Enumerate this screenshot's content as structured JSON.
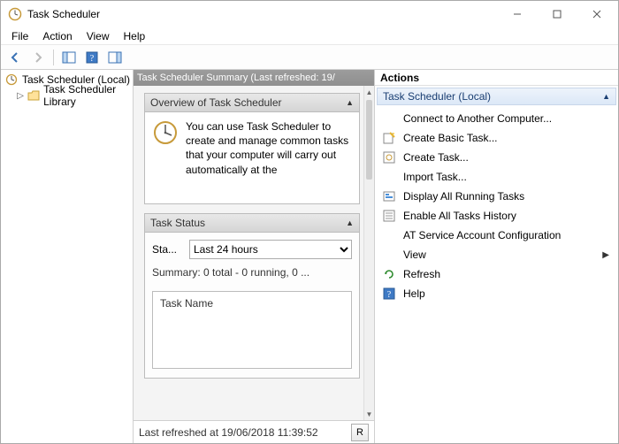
{
  "title": "Task Scheduler",
  "menu": {
    "file": "File",
    "action": "Action",
    "view": "View",
    "help": "Help"
  },
  "tree": {
    "root": "Task Scheduler (Local)",
    "library": "Task Scheduler Library"
  },
  "mid": {
    "header": "Task Scheduler Summary (Last refreshed: 19/",
    "overview_head": "Overview of Task Scheduler",
    "overview_text": "You can use Task Scheduler to create and manage common tasks that your computer will carry out automatically at the",
    "status_head": "Task Status",
    "status_label": "Sta...",
    "status_select": "Last 24 hours",
    "status_summary": "Summary: 0 total - 0 running, 0 ...",
    "task_name": "Task Name",
    "footer": "Last refreshed at 19/06/2018 11:39:52",
    "footer_btn": "R"
  },
  "actions": {
    "title": "Actions",
    "subhead": "Task Scheduler (Local)",
    "items": {
      "connect": "Connect to Another Computer...",
      "create_basic": "Create Basic Task...",
      "create": "Create Task...",
      "import": "Import Task...",
      "display_running": "Display All Running Tasks",
      "enable_history": "Enable All Tasks History",
      "at_service": "AT Service Account Configuration",
      "view": "View",
      "refresh": "Refresh",
      "help": "Help"
    }
  }
}
